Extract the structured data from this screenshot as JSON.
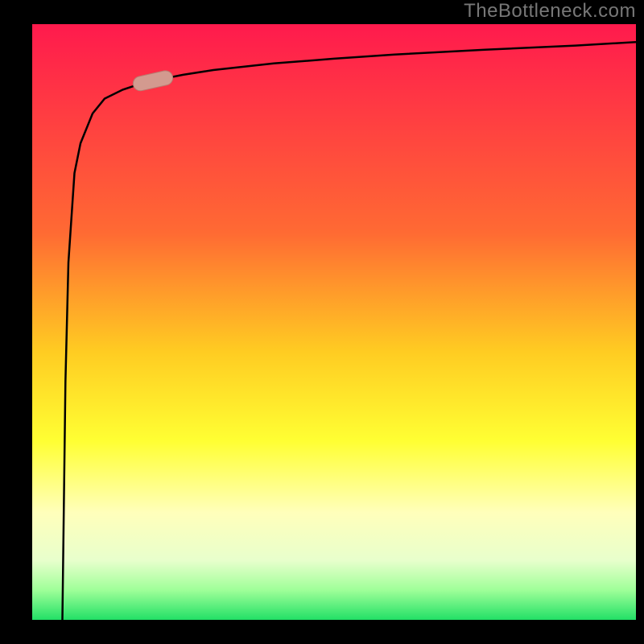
{
  "watermark": "TheBottleneck.com",
  "colors": {
    "frame": "#000000",
    "curve": "#000000",
    "marker_fill": "#d39a8f",
    "marker_stroke": "#b97a6f",
    "grad_top": "#ff1a4d",
    "grad_35": "#ff6a33",
    "grad_55": "#ffcc22",
    "grad_70": "#ffff33",
    "grad_82": "#ffffbb",
    "grad_90": "#e8ffcc",
    "grad_95": "#9fff99",
    "grad_bottom": "#22e066"
  },
  "chart_data": {
    "type": "line",
    "title": "",
    "xlabel": "",
    "ylabel": "",
    "xlim": [
      0,
      100
    ],
    "ylim": [
      0,
      100
    ],
    "marker_at_x": 20,
    "series": [
      {
        "name": "curve",
        "note": "steep logarithmic-like curve; y≈0 at x≈5 then rises rapidly and asymptotes near top (~97)",
        "x": [
          5,
          5.5,
          6,
          7,
          8,
          10,
          12,
          15,
          18,
          20,
          25,
          30,
          40,
          50,
          60,
          75,
          90,
          100
        ],
        "y": [
          0,
          40,
          60,
          75,
          80,
          85,
          87.5,
          89,
          90,
          90.5,
          91.5,
          92.3,
          93.4,
          94.2,
          94.9,
          95.7,
          96.4,
          97
        ]
      }
    ]
  }
}
